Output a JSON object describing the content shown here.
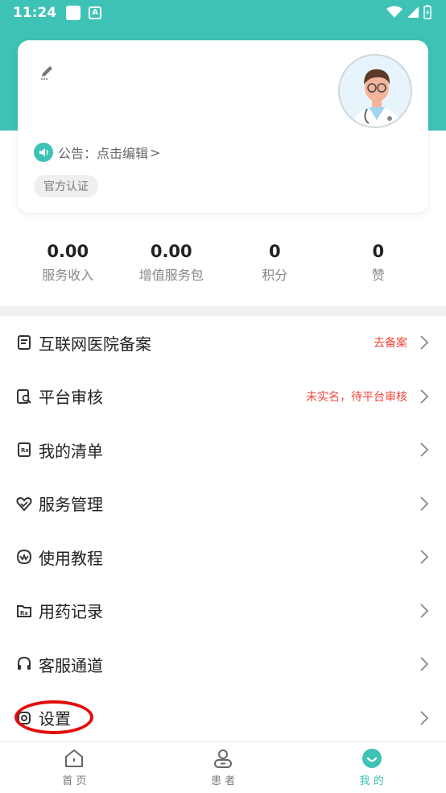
{
  "status_bar": {
    "time": "11:24",
    "a_icon_text": "A"
  },
  "profile": {
    "notice_label": "公告：点击编辑",
    "notice_arrow": ">",
    "badge": "官方认证"
  },
  "stats": [
    {
      "value": "0.00",
      "label": "服务收入"
    },
    {
      "value": "0.00",
      "label": "增值服务包"
    },
    {
      "value": "0",
      "label": "积分"
    },
    {
      "value": "0",
      "label": "赞"
    }
  ],
  "menu": [
    {
      "label": "互联网医院备案",
      "status": "去备案",
      "icon": "document-icon"
    },
    {
      "label": "平台审核",
      "status": "未实名，待平台审核",
      "icon": "audit-icon"
    },
    {
      "label": "我的清单",
      "status": "",
      "icon": "rx-list-icon"
    },
    {
      "label": "服务管理",
      "status": "",
      "icon": "heart-service-icon"
    },
    {
      "label": "使用教程",
      "status": "",
      "icon": "tutorial-icon"
    },
    {
      "label": "用药记录",
      "status": "",
      "icon": "rx-folder-icon"
    },
    {
      "label": "客服通道",
      "status": "",
      "icon": "headset-icon"
    },
    {
      "label": "设置",
      "status": "",
      "icon": "settings-icon"
    }
  ],
  "tabs": [
    {
      "label": "首 页",
      "icon": "home-icon",
      "active": false
    },
    {
      "label": "患 者",
      "icon": "patients-icon",
      "active": false
    },
    {
      "label": "我 的",
      "icon": "profile-icon",
      "active": true
    }
  ],
  "colors": {
    "accent": "#3ec2b6",
    "alert": "#f0453a",
    "highlight": "#e20d0d"
  }
}
